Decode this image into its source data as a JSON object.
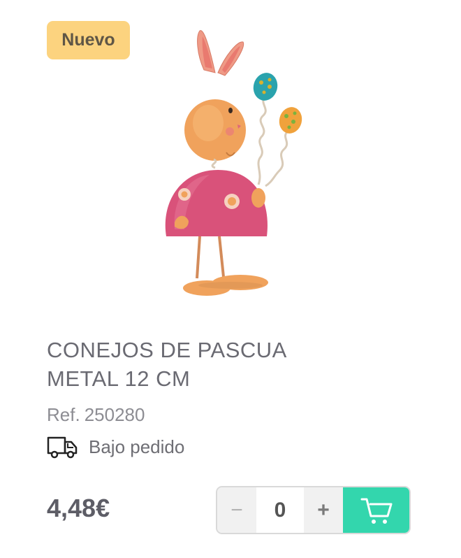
{
  "badge": {
    "label": "Nuevo"
  },
  "product": {
    "title_line1": "CONEJOS DE PASCUA",
    "title_line2": "METAL 12 CM",
    "ref_label": "Ref.",
    "ref_number": "250280",
    "image_icon": "bunny-figurine-image"
  },
  "delivery": {
    "icon": "truck-icon",
    "status": "Bajo pedido"
  },
  "price": {
    "value": "4,48€"
  },
  "quantity": {
    "minus_label": "−",
    "plus_label": "+",
    "value": "0"
  },
  "cart": {
    "icon": "cart-icon"
  },
  "colors": {
    "badge_bg": "#fcd37f",
    "cart_bg": "#33d6ad",
    "text_gray": "#6a6a72"
  }
}
